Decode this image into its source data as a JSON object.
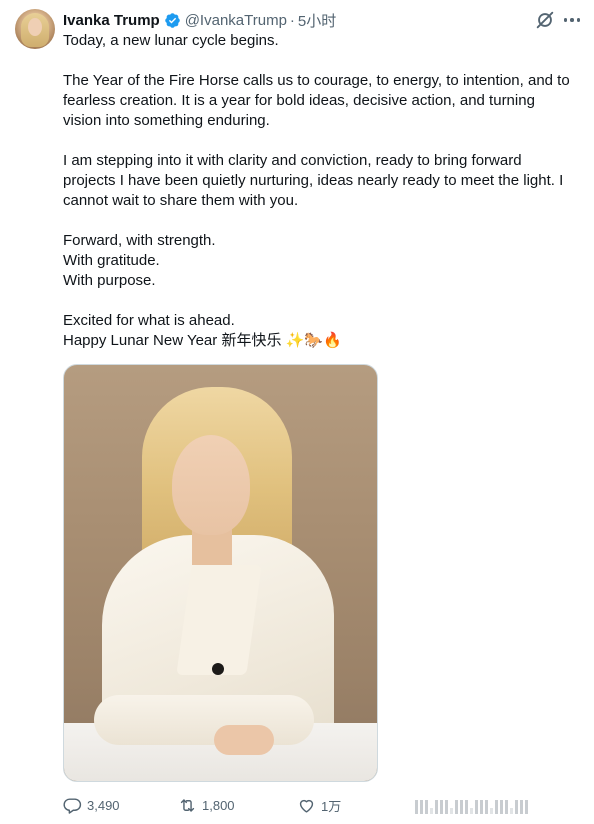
{
  "author": {
    "name": "Ivanka Trump",
    "handle": "@IvankaTrump",
    "separator": "·",
    "time": "5小时"
  },
  "icons": {
    "avatar": "avatar-photo",
    "verified": "verified-badge-icon",
    "grok": "grok-icon",
    "more": "more-icon",
    "reply": "reply-icon",
    "retweet": "retweet-icon",
    "like": "like-icon",
    "views": "views-icon"
  },
  "colors": {
    "verified": "#1d9bf0",
    "text": "#0f1419",
    "muted": "#536471"
  },
  "body": {
    "p1": "Today, a new lunar cycle begins.",
    "p2": [
      "The Year of the Fire Horse calls us to courage, to energy, to intention, and to",
      "fearless creation. It is a year for bold ideas, decisive action, and turning",
      "vision into something enduring."
    ],
    "p3": [
      "I am stepping into it with clarity and conviction, ready to bring forward",
      "projects I have been quietly nurturing, ideas nearly ready to meet the light. I",
      "cannot wait to share them with you."
    ],
    "p4": [
      "Forward, with strength.",
      "With gratitude.",
      "With purpose."
    ],
    "p5": [
      "Excited for what is ahead.",
      "Happy Lunar New Year 新年快乐 ✨🐎🔥"
    ]
  },
  "stats": {
    "replies": "3,490",
    "retweets": "1,800",
    "likes": "1万",
    "views": ""
  }
}
